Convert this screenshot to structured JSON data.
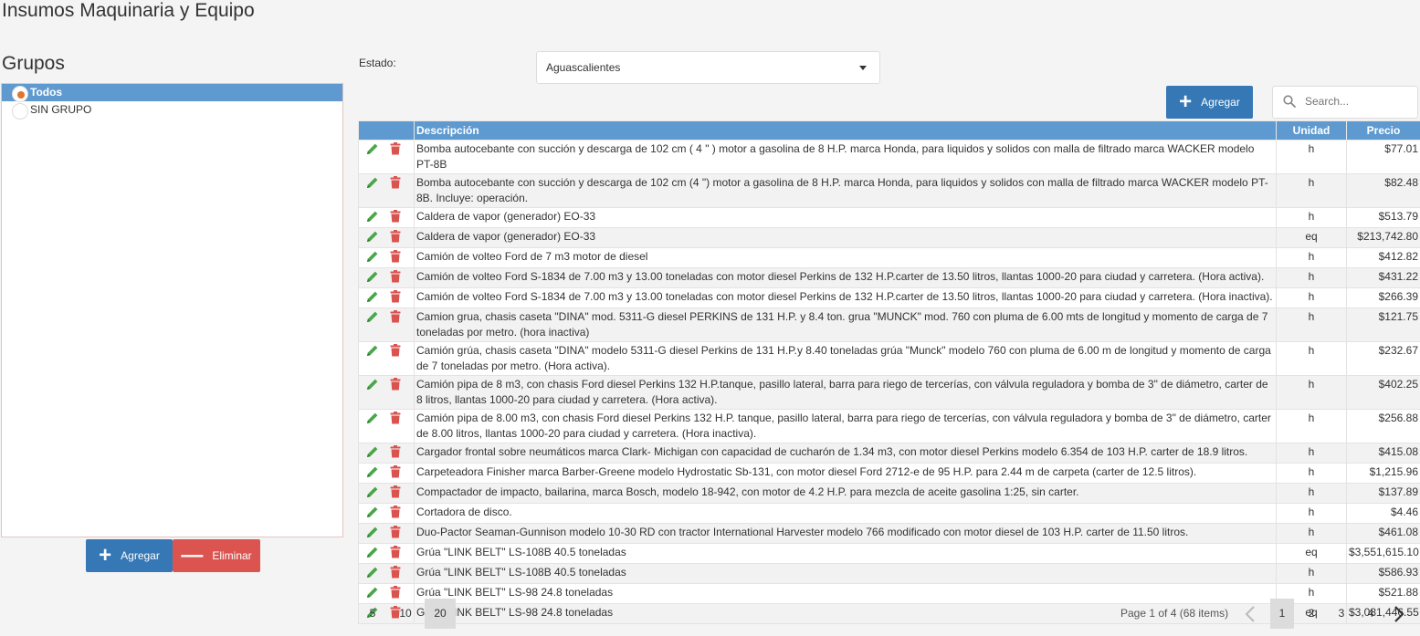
{
  "page_title": "Insumos Maquinaria y Equipo",
  "groups": {
    "title": "Grupos",
    "items": [
      {
        "label": "Todos",
        "selected": true
      },
      {
        "label": "SIN GRUPO",
        "selected": false
      }
    ],
    "add_label": "Agregar",
    "delete_label": "Eliminar"
  },
  "filter": {
    "estado_label": "Estado:",
    "estado_value": "Aguascalientes"
  },
  "toolbar": {
    "add_label": "Agregar",
    "search_placeholder": "Search..."
  },
  "table": {
    "columns": [
      "Descripción",
      "Unidad",
      "Precio"
    ],
    "rows": [
      {
        "descripcion": "Bomba autocebante con succión y descarga de 102 cm ( 4 \" ) motor a gasolina de 8 H.P. marca Honda, para liquidos y solidos con malla de filtrado marca WACKER modelo PT-8B",
        "unidad": "h",
        "precio": "$77.01"
      },
      {
        "descripcion": "Bomba autocebante con succión y descarga de 102 cm (4 \") motor a gasolina de 8 H.P. marca Honda, para liquidos y solidos con malla de filtrado marca WACKER modelo PT-8B. Incluye: operación.",
        "unidad": "h",
        "precio": "$82.48"
      },
      {
        "descripcion": "Caldera de vapor (generador) EO-33",
        "unidad": "h",
        "precio": "$513.79"
      },
      {
        "descripcion": "Caldera de vapor (generador) EO-33",
        "unidad": "eq",
        "precio": "$213,742.80"
      },
      {
        "descripcion": "Camión de volteo Ford de 7 m3 motor de diesel",
        "unidad": "h",
        "precio": "$412.82"
      },
      {
        "descripcion": "Camión de volteo Ford S-1834 de 7.00 m3 y 13.00 toneladas con motor diesel Perkins de 132 H.P.carter de 13.50 litros, llantas 1000-20 para ciudad y carretera. (Hora activa).",
        "unidad": "h",
        "precio": "$431.22"
      },
      {
        "descripcion": "Camión de volteo Ford S-1834 de 7.00 m3 y 13.00 toneladas con motor diesel Perkins de 132 H.P.carter de 13.50 litros, llantas 1000-20 para ciudad y carretera. (Hora inactiva).",
        "unidad": "h",
        "precio": "$266.39"
      },
      {
        "descripcion": "Camion grua, chasis caseta \"DINA\" mod. 5311-G diesel PERKINS de 131 H.P. y 8.4 ton. grua \"MUNCK\" mod. 760 con pluma de 6.00 mts de longitud y momento de carga de 7 toneladas por metro. (hora inactiva)",
        "unidad": "h",
        "precio": "$121.75"
      },
      {
        "descripcion": "Camión grúa, chasis caseta \"DINA\" modelo 5311-G diesel Perkins de 131 H.P.y 8.40 toneladas grúa \"Munck\" modelo 760 con pluma de 6.00 m de longitud y momento de carga de 7 toneladas por metro. (Hora activa).",
        "unidad": "h",
        "precio": "$232.67"
      },
      {
        "descripcion": "Camión pipa de 8 m3, con chasis Ford diesel Perkins 132 H.P.tanque, pasillo lateral, barra para riego de tercerías, con válvula reguladora y bomba de 3\" de diámetro, carter de 8 litros, llantas 1000-20 para ciudad y carretera. (Hora activa).",
        "unidad": "h",
        "precio": "$402.25"
      },
      {
        "descripcion": "Camión pipa de 8.00 m3, con chasis Ford diesel Perkins 132 H.P. tanque, pasillo lateral, barra para riego de tercerías, con válvula reguladora y bomba de 3\" de diámetro, carter de 8.00 litros, llantas 1000-20 para ciudad y carretera. (Hora inactiva).",
        "unidad": "h",
        "precio": "$256.88"
      },
      {
        "descripcion": "Cargador frontal sobre neumáticos marca Clark- Michigan con capacidad de cucharón de 1.34 m3, con motor diesel Perkins modelo 6.354 de 103 H.P. carter de 18.9 litros.",
        "unidad": "h",
        "precio": "$415.08"
      },
      {
        "descripcion": "Carpeteadora Finisher marca Barber-Greene modelo Hydrostatic Sb-131, con motor diesel Ford 2712-e de 95 H.P. para 2.44 m de carpeta (carter de 12.5 litros).",
        "unidad": "h",
        "precio": "$1,215.96"
      },
      {
        "descripcion": "Compactador de impacto, bailarina, marca Bosch, modelo 18-942, con motor de 4.2 H.P. para mezcla de aceite gasolina 1:25, sin carter.",
        "unidad": "h",
        "precio": "$137.89"
      },
      {
        "descripcion": "Cortadora de disco.",
        "unidad": "h",
        "precio": "$4.46"
      },
      {
        "descripcion": "Duo-Pactor Seaman-Gunnison modelo 10-30 RD con tractor International Harvester modelo 766 modificado con motor diesel de 103 H.P. carter de 11.50 litros.",
        "unidad": "h",
        "precio": "$461.08"
      },
      {
        "descripcion": "Grúa \"LINK BELT\" LS-108B 40.5 toneladas",
        "unidad": "eq",
        "precio": "$3,551,615.10"
      },
      {
        "descripcion": "Grúa \"LINK BELT\" LS-108B 40.5 toneladas",
        "unidad": "h",
        "precio": "$586.93"
      },
      {
        "descripcion": "Grúa \"LINK BELT\" LS-98 24.8 toneladas",
        "unidad": "h",
        "precio": "$521.88"
      },
      {
        "descripcion": "Grúa \"LINK BELT\" LS-98 24.8 toneladas",
        "unidad": "eq",
        "precio": "$3,081,446.55"
      }
    ]
  },
  "pager": {
    "sizes": [
      "5",
      "10",
      "20"
    ],
    "active_size": "20",
    "info": "Page 1 of 4 (68 items)",
    "pages": [
      "1",
      "2",
      "3",
      "4"
    ],
    "current_page": "1"
  },
  "icons": {
    "edit": "pencil-icon",
    "delete": "trash-icon",
    "search": "search-icon",
    "add": "plus-icon",
    "remove": "minus-icon",
    "prev": "chevron-left-icon",
    "next": "chevron-right-icon",
    "dropdown": "caret-down-icon"
  },
  "colors": {
    "header_blue": "#5e9ad0",
    "primary_button": "#3578b5",
    "danger_button": "#db5450",
    "edit_icon": "#4aa64a",
    "delete_icon": "#d9534f",
    "radio_dot": "#e2742b"
  }
}
